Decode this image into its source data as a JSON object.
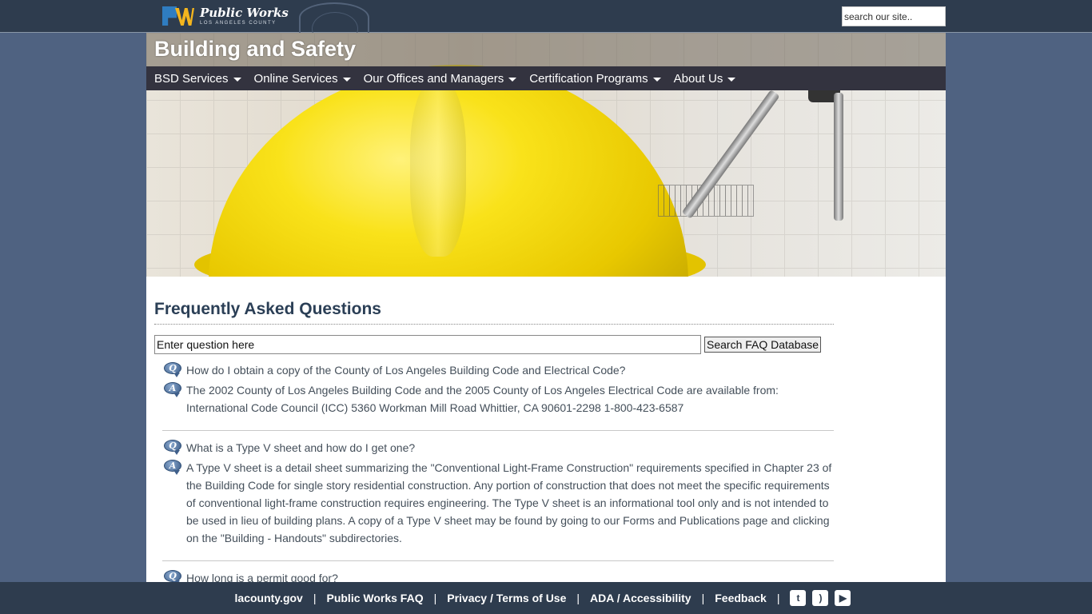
{
  "header": {
    "logo_title": "Public Works",
    "logo_subtitle": "LOS ANGELES COUNTY",
    "search_placeholder": "search our site.."
  },
  "banner": {
    "title": "Building and Safety"
  },
  "nav": {
    "items": [
      {
        "label": "BSD Services"
      },
      {
        "label": "Online Services"
      },
      {
        "label": "Our Offices and Managers"
      },
      {
        "label": "Certification Programs"
      },
      {
        "label": "About Us"
      }
    ]
  },
  "faq": {
    "title": "Frequently Asked Questions",
    "search_placeholder": "Enter question here",
    "search_button": "Search FAQ Database",
    "items": [
      {
        "q": "How do I obtain a copy of the County of Los Angeles Building Code and Electrical Code?",
        "a": "The 2002 County of Los Angeles Building Code and the 2005 County of Los Angeles Electrical Code are available from: International Code Council (ICC) 5360 Workman Mill Road Whittier, CA 90601-2298 1-800-423-6587"
      },
      {
        "q": "What is a Type V sheet and how do I get one?",
        "a": "A Type V sheet is a detail sheet summarizing the \"Conventional Light-Frame Construction\" requirements specified in Chapter 23 of the Building Code for single story residential construction. Any portion of construction that does not meet the specific requirements of conventional light-frame construction requires engineering. The Type V sheet is an informational tool only and is not intended to be used in lieu of building plans. A copy of a Type V sheet may be found by going to our Forms and Publications page and clicking on the \"Building - Handouts\" subdirectories."
      },
      {
        "q": "How long is a permit good for?",
        "a": ""
      }
    ],
    "q_icon_letter": "Q",
    "a_icon_letter": "A"
  },
  "footer": {
    "links": [
      {
        "label": "lacounty.gov"
      },
      {
        "label": "Public Works FAQ"
      },
      {
        "label": "Privacy / Terms of Use"
      },
      {
        "label": "ADA / Accessibility"
      },
      {
        "label": "Feedback"
      }
    ],
    "separator": "|",
    "social": [
      {
        "icon": "twitter-icon",
        "glyph": "t"
      },
      {
        "icon": "rss-icon",
        "glyph": ")"
      },
      {
        "icon": "youtube-icon",
        "glyph": "▶"
      }
    ]
  }
}
